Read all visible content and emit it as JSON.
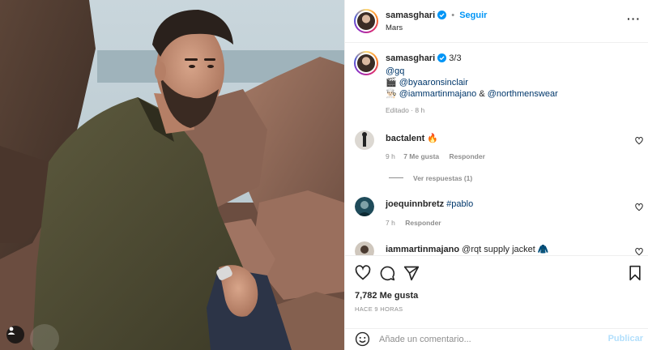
{
  "post": {
    "author": {
      "username": "samasghari",
      "verified": true,
      "follow_label": "Seguir",
      "separator": "•",
      "location": "Mars"
    },
    "caption": {
      "username": "samasghari",
      "counter": "3/3",
      "line1_mention": "@gq",
      "line2_icon": "🎬",
      "line2_mention": "@byaaronsinclair",
      "line3_icon": "👨🏻‍🍳",
      "line3_mention_a": "@iammartinmajano",
      "line3_and": "&",
      "line3_mention_b": "@northmenswear",
      "meta": "Editado · 8 h"
    },
    "comments": [
      {
        "username": "bactalent",
        "text": "🔥",
        "time": "9 h",
        "likes": "7 Me gusta",
        "reply": "Responder",
        "view_replies": "Ver respuestas (1)"
      },
      {
        "username": "joequinnbretz",
        "text": "#pablo",
        "time": "7 h",
        "reply": "Responder"
      },
      {
        "username": "iammartinmajano",
        "text": "@rqt supply jacket 🧥"
      }
    ],
    "likes_text": "7,782 Me gusta",
    "time_ago": "HACE 9 HORAS",
    "add_comment": {
      "placeholder": "Añade un comentario...",
      "publish_label": "Publicar"
    }
  },
  "icons": {
    "more": "more-options-icon",
    "like": "heart-icon",
    "comment": "comment-icon",
    "share": "share-icon",
    "save": "bookmark-icon",
    "emoji": "emoji-icon",
    "tag": "user-tag-icon"
  },
  "colors": {
    "link": "#0095f6",
    "mention": "#00376b",
    "verified": "#0095f6",
    "muted": "#8e8e8e",
    "publish_disabled": "#b2dffc"
  }
}
